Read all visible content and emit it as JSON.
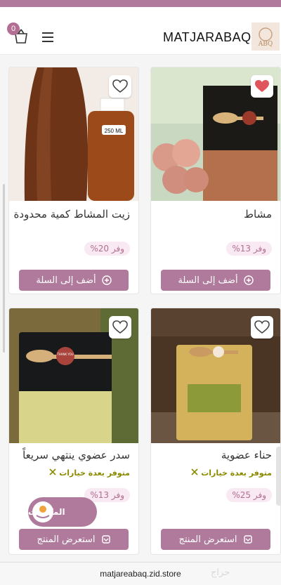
{
  "header": {
    "brand": "MATJARABAQ",
    "logo_text": "ABQ",
    "cart_count": "0",
    "cart_icon": "shopping-basket-icon",
    "menu_icon": "hamburger-menu-icon"
  },
  "products": [
    {
      "title": "زيت المشاط كمية محدودة",
      "bottle_label": "250 ML",
      "save": "وفر 20%",
      "button": "أضف إلى السلة",
      "button_icon": "plus-circle-icon",
      "favorited": false
    },
    {
      "title": "مشاط",
      "save": "وفر 13%",
      "button": "أضف إلى السلة",
      "button_icon": "plus-circle-icon",
      "favorited": true
    },
    {
      "title": "سدر عضوي ينتهي سريعاً",
      "pouch_label": "THANK YOU",
      "variants": "متوفر بعدة خيارات",
      "save": "وفر 13%",
      "button": "استعرض المنتج",
      "button_icon": "view-product-icon",
      "favorited": false
    },
    {
      "title": "حناء عضوية",
      "variants": "متوفر بعدة خيارات",
      "save": "وفر 25%",
      "button": "استعرض المنتج",
      "button_icon": "view-product-icon",
      "favorited": false
    }
  ],
  "rewards": {
    "label": "المكافآت"
  },
  "browser": {
    "url": "matjareabaq.zid.store"
  },
  "watermark": "حراج",
  "colors": {
    "accent": "#b07a9c",
    "heart_active": "#e0555b",
    "variants_text": "#8a8a00"
  }
}
